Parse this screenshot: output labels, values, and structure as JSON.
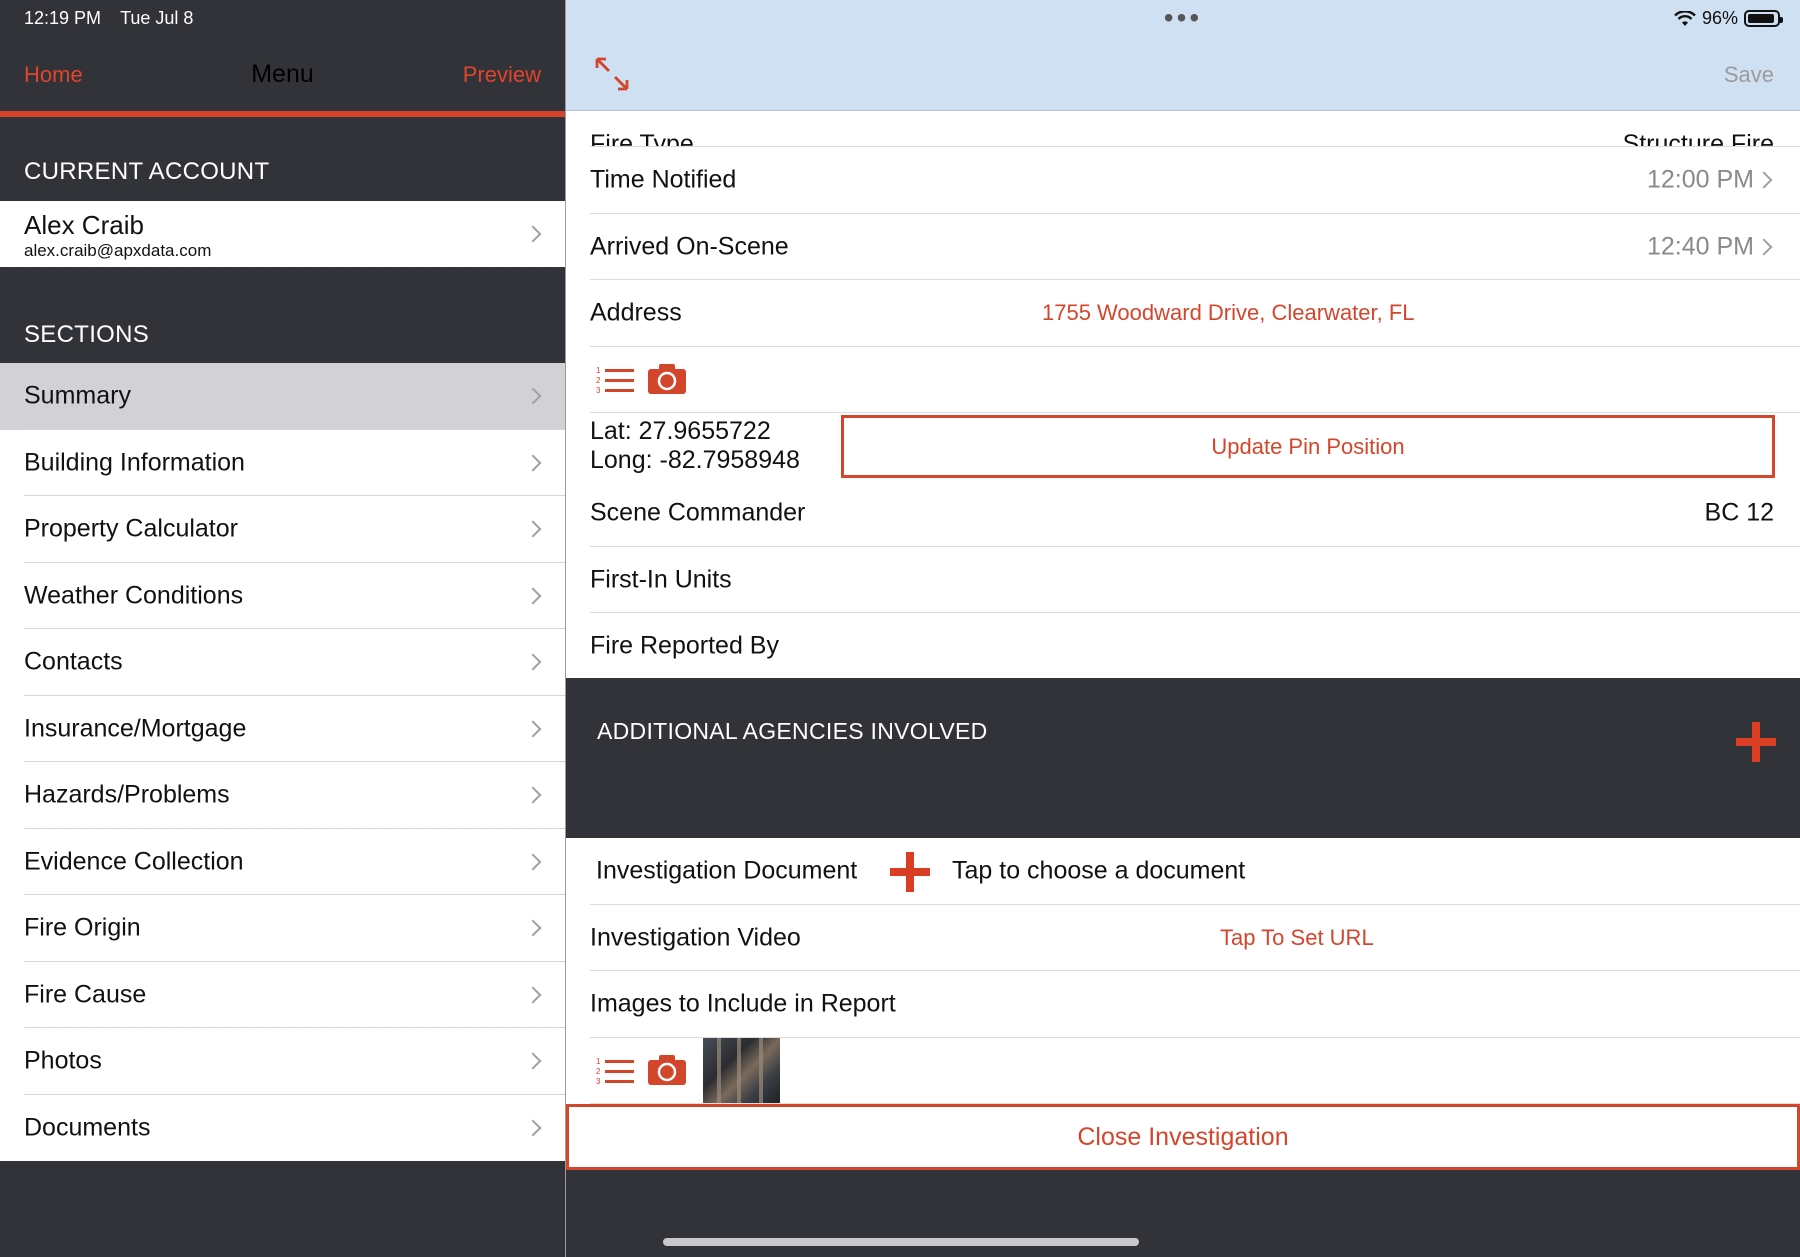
{
  "status": {
    "time": "12:19 PM",
    "date": "Tue Jul 8",
    "battery": "96%"
  },
  "left_nav": {
    "home": "Home",
    "title": "Menu",
    "preview": "Preview"
  },
  "current_account": {
    "header": "CURRENT ACCOUNT",
    "name": "Alex Craib",
    "email": "alex.craib@apxdata.com"
  },
  "sections": {
    "header": "SECTIONS",
    "selected": "Summary",
    "items": [
      {
        "label": "Summary"
      },
      {
        "label": "Building Information"
      },
      {
        "label": "Property Calculator"
      },
      {
        "label": "Weather Conditions"
      },
      {
        "label": "Contacts"
      },
      {
        "label": "Insurance/Mortgage"
      },
      {
        "label": "Hazards/Problems"
      },
      {
        "label": "Evidence Collection"
      },
      {
        "label": "Fire Origin"
      },
      {
        "label": "Fire Cause"
      },
      {
        "label": "Photos"
      },
      {
        "label": "Documents"
      }
    ]
  },
  "right_nav": {
    "save": "Save"
  },
  "form": {
    "fire_type": {
      "label": "Fire Type",
      "value": "Structure Fire"
    },
    "time_notified": {
      "label": "Time Notified",
      "value": "12:00 PM"
    },
    "arrived": {
      "label": "Arrived On-Scene",
      "value": "12:40 PM"
    },
    "address": {
      "label": "Address",
      "value": "1755 Woodward Drive, Clearwater, FL"
    },
    "lat": "Lat: 27.9655722",
    "long": "Long: -82.7958948",
    "update_pin": "Update Pin Position",
    "scene_commander": {
      "label": "Scene Commander",
      "value": "BC 12"
    },
    "first_in": {
      "label": "First-In Units",
      "value": ""
    },
    "reported_by": {
      "label": "Fire Reported By",
      "value": ""
    }
  },
  "agencies": {
    "header": "ADDITIONAL AGENCIES INVOLVED"
  },
  "documents": {
    "doc_label": "Investigation Document",
    "doc_tap": "Tap to choose a document",
    "video_label": "Investigation Video",
    "video_value": "Tap To Set URL",
    "images_label": "Images to Include in Report"
  },
  "close_button": "Close Investigation",
  "colors": {
    "accent": "#d4462c",
    "dark": "#323239",
    "nav_blue": "#cfe0f3"
  }
}
